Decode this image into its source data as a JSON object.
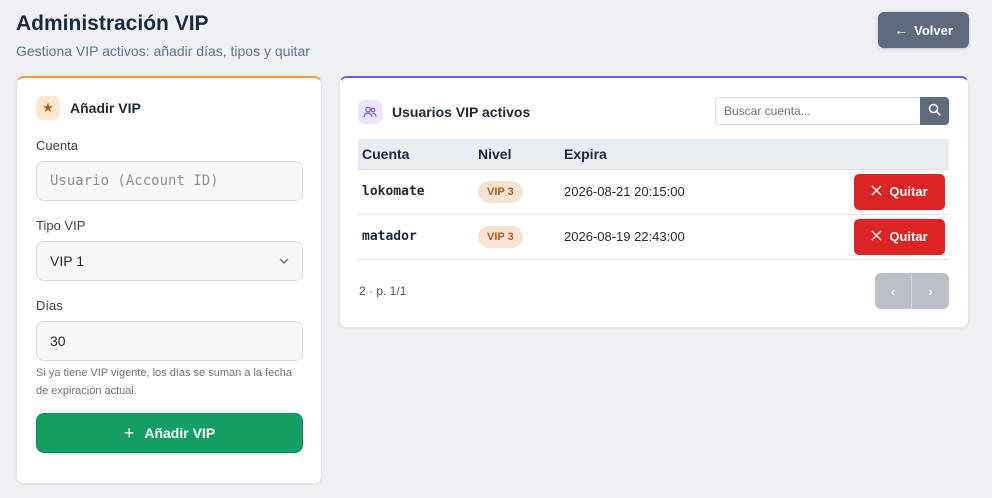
{
  "header": {
    "title": "Administración VIP",
    "subtitle": "Gestiona VIP activos: añadir días, tipos y quitar",
    "back_label": "Volver"
  },
  "add_form": {
    "title": "Añadir VIP",
    "account_label": "Cuenta",
    "account_placeholder": "Usuario (Account ID)",
    "type_label": "Tipo VIP",
    "type_value": "VIP 1",
    "days_label": "Días",
    "days_value": "30",
    "hint": "Si ya tiene VIP vigente, los días se suman a la fecha de expiración actual.",
    "submit_label": "Añadir VIP"
  },
  "active_list": {
    "title": "Usuarios VIP activos",
    "search_placeholder": "Buscar cuenta...",
    "columns": [
      "Cuenta",
      "Nivel",
      "Expira"
    ],
    "rows": [
      {
        "account": "lokomate",
        "level": "VIP 3",
        "expires": "2026-08-21 20:15:00",
        "action": "Quitar"
      },
      {
        "account": "matador",
        "level": "VIP 3",
        "expires": "2026-08-19 22:43:00",
        "action": "Quitar"
      }
    ],
    "pager_info": "2 · p. 1/1",
    "prev_label": "‹",
    "next_label": "›"
  },
  "colors": {
    "accent_orange": "#f29b38",
    "accent_purple": "#7c52e8",
    "success": "#139f63",
    "danger": "#dd2424",
    "neutral_button": "#5f6b7d"
  },
  "icons": {
    "back": "arrow-left-icon",
    "add_card": "star-icon",
    "list_card": "users-icon",
    "search": "search-icon",
    "select": "chevron-down-icon",
    "submit": "plus-icon",
    "remove": "close-icon"
  }
}
